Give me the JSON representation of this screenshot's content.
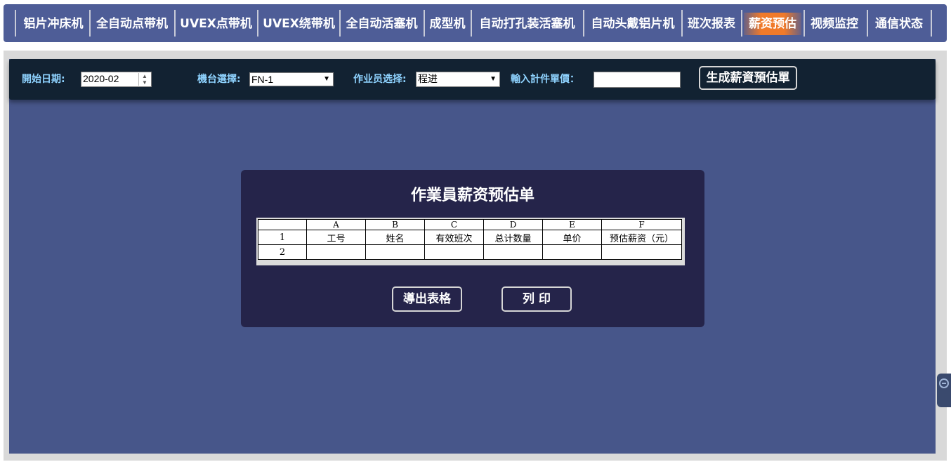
{
  "nav": {
    "tabs": [
      {
        "label": "铝片冲床机"
      },
      {
        "label": "全自动点带机"
      },
      {
        "label": "UVEX点带机"
      },
      {
        "label": "UVEX绕带机"
      },
      {
        "label": "全自动活塞机"
      },
      {
        "label": "成型机"
      },
      {
        "label": "自动打孔装活塞机"
      },
      {
        "label": "自动头戴铝片机"
      },
      {
        "label": "班次报表"
      },
      {
        "label": "薪资预估",
        "active": true
      },
      {
        "label": "视频监控"
      },
      {
        "label": "通信状态"
      }
    ],
    "active_color": "#f07a2a"
  },
  "toolbar": {
    "start_date_label": "開始日期:",
    "start_date_value": "2020-02",
    "machine_label": "機台選擇:",
    "machine_value": "FN-1",
    "operator_label": "作业员选择:",
    "operator_value": "程进",
    "price_label": "輸入計件單價：",
    "price_value": "",
    "generate_button": "生成薪資預估單"
  },
  "dialog": {
    "title": "作業員薪资预估单",
    "columns": [
      "A",
      "B",
      "C",
      "D",
      "E",
      "F"
    ],
    "rows": [
      {
        "num": "1",
        "cells": [
          "工号",
          "姓名",
          "有效班次",
          "总计数量",
          "单价",
          "预估薪资（元）"
        ]
      },
      {
        "num": "2",
        "cells": [
          "",
          "",
          "",
          "",
          "",
          ""
        ]
      }
    ],
    "export_button": "導出表格",
    "print_button": "列 印"
  },
  "colors": {
    "nav_bg": "#4e5d97",
    "toolbar_bg": "#122232",
    "panel_bg": "#47568a",
    "dialog_bg": "#25244a",
    "label_color": "#8fd3ff"
  }
}
